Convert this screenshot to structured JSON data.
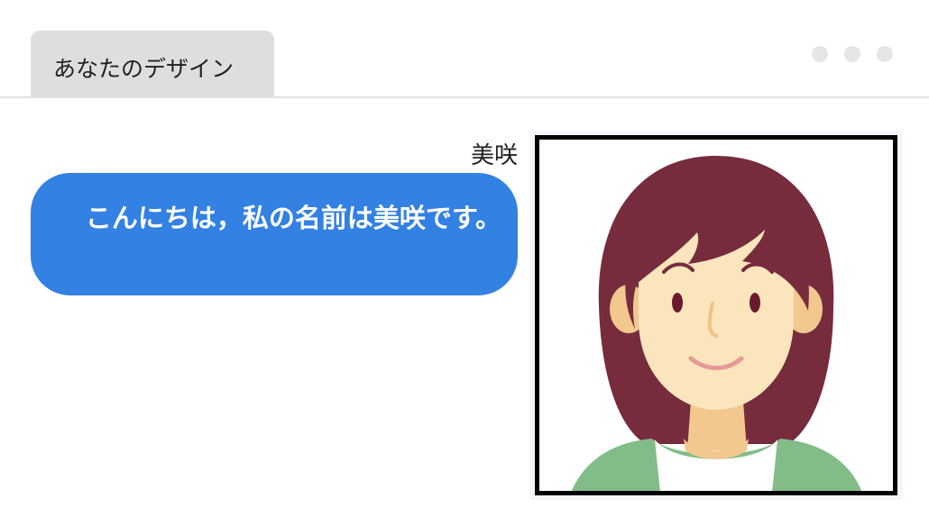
{
  "tab": {
    "label": "あなたのデザイン"
  },
  "chat": {
    "sender": "美咲",
    "message": "こんにちは，私の名前は美咲です。"
  },
  "avatar": {
    "description_icon": "woman-avatar-icon"
  }
}
